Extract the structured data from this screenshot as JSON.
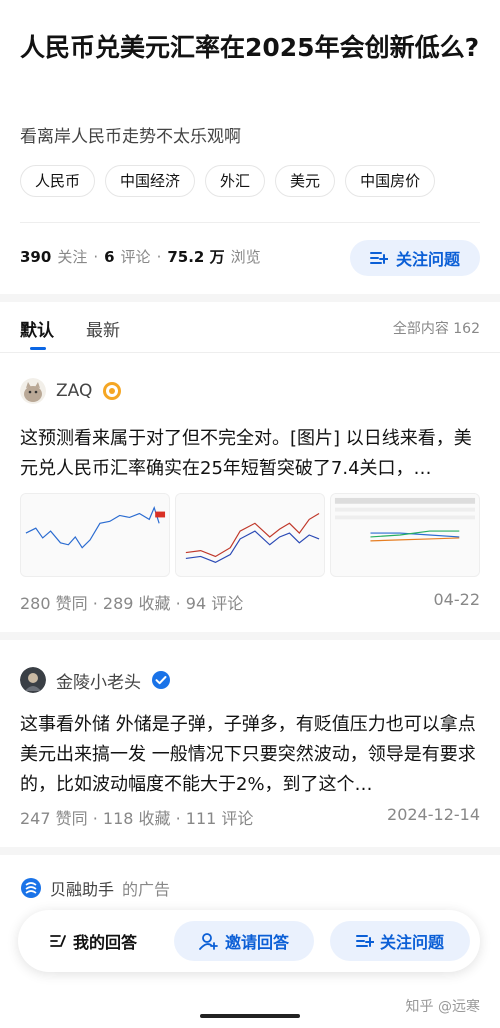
{
  "question": {
    "title": "人民币兑美元汇率在2025年会创新低么?",
    "description": "看离岸人民币走势不太乐观啊",
    "tags": [
      "人民币",
      "中国经济",
      "外汇",
      "美元",
      "中国房价"
    ],
    "stats": {
      "followers_num": "390",
      "followers_label": "关注",
      "comments_num": "6",
      "comments_label": "评论",
      "views_num": "75.2 万",
      "views_label": "浏览"
    },
    "follow_button": "关注问题"
  },
  "tabs": {
    "default": "默认",
    "latest": "最新",
    "all_content": "全部内容 162"
  },
  "answers": [
    {
      "author": "ZAQ",
      "text": "这预测看来属于对了但不完全对。[图片] 以日线来看，美元兑人民币汇率确实在25年短暂突破了7.4关口，…",
      "meta": "280 赞同 · 289 收藏 · 94 评论",
      "date": "04-22"
    },
    {
      "author": "金陵小老头",
      "text": "这事看外储 外储是子弹，子弹多，有贬值压力也可以拿点美元出来搞一发 一般情况下只要突然波动，领导是有要求的，比如波动幅度不能大于2%，到了这个…",
      "meta": "247 赞同 · 118 收藏 · 111 评论",
      "date": "2024-12-14"
    }
  ],
  "ad": {
    "name": "贝融助手",
    "suffix": "的广告"
  },
  "bottom_bar": {
    "my_answer": "我的回答",
    "invite": "邀请回答",
    "follow": "关注问题"
  },
  "watermark": "知乎 @远寒",
  "colors": {
    "accent": "#0b66e4",
    "accent_bg": "#eaf1fd"
  }
}
